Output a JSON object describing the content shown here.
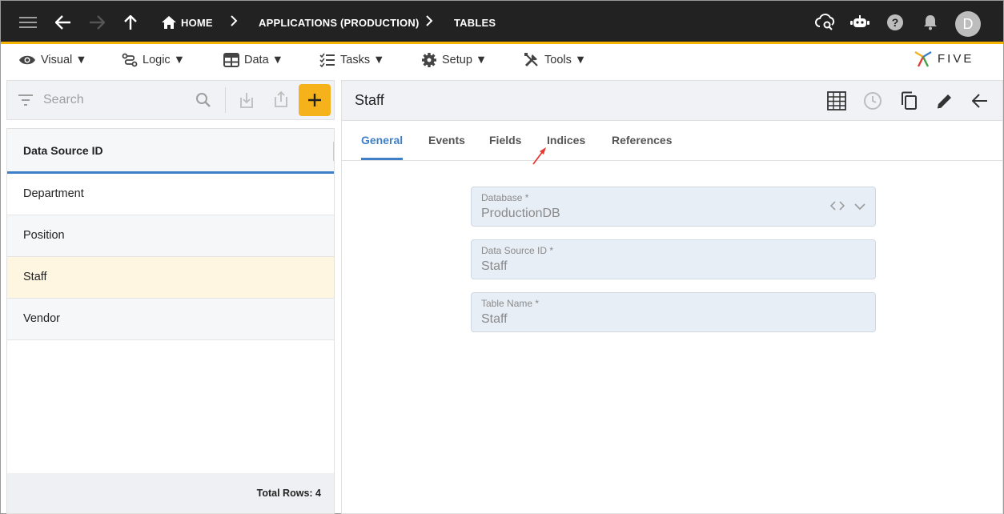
{
  "topbar": {
    "breadcrumbs": [
      "HOME",
      "APPLICATIONS (PRODUCTION)",
      "TABLES"
    ],
    "avatar_letter": "D"
  },
  "menubar": {
    "items": [
      {
        "label": "Visual ▼",
        "icon": "eye-icon"
      },
      {
        "label": "Logic ▼",
        "icon": "flow-icon"
      },
      {
        "label": "Data ▼",
        "icon": "table-icon"
      },
      {
        "label": "Tasks ▼",
        "icon": "checklist-icon"
      },
      {
        "label": "Setup ▼",
        "icon": "gear-icon"
      },
      {
        "label": "Tools ▼",
        "icon": "tools-icon"
      }
    ],
    "logo_text": "FIVE"
  },
  "left": {
    "search_placeholder": "Search",
    "column_header": "Data Source ID",
    "rows": [
      "Department",
      "Position",
      "Staff",
      "Vendor"
    ],
    "selected_row": "Staff",
    "footer": "Total Rows: 4"
  },
  "right": {
    "title": "Staff",
    "tabs": [
      "General",
      "Events",
      "Fields",
      "Indices",
      "References"
    ],
    "active_tab": "General",
    "fields": [
      {
        "label": "Database *",
        "value": "ProductionDB"
      },
      {
        "label": "Data Source ID *",
        "value": "Staff"
      },
      {
        "label": "Table Name *",
        "value": "Staff"
      }
    ]
  },
  "colors": {
    "topbar_bg": "#222222",
    "accent_yellow": "#f6b21b",
    "accent_blue": "#3f7fc7",
    "selected_row": "#fff6e1"
  }
}
